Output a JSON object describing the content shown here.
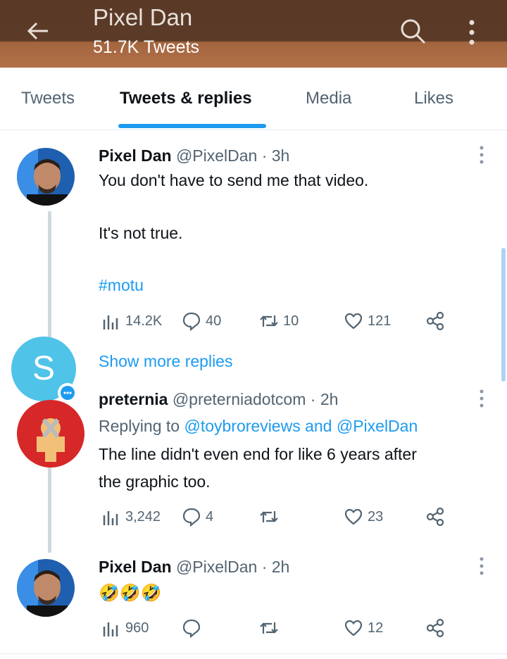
{
  "header": {
    "title": "Pixel Dan",
    "subtitle": "51.7K Tweets"
  },
  "tabs": [
    "Tweets",
    "Tweets & replies",
    "Media",
    "Likes"
  ],
  "tweets": [
    {
      "name": "Pixel Dan",
      "handle": "@PixelDan · 3h",
      "lines": [
        "You don't have to send me that video.",
        "It's not true."
      ],
      "hashtag": "#motu",
      "views": "14.2K",
      "replies": "40",
      "retweets": "10",
      "likes": "121"
    },
    {
      "name": "preternia",
      "handle": "@preterniadotcom · 2h",
      "replying_prefix": "Replying to",
      "replying_to": "@toybroreviews and @PixelDan",
      "lines": [
        "The line didn't even end for like 6 years after",
        "the graphic too."
      ],
      "views": "3,242",
      "replies": "4",
      "retweets": "",
      "likes": "23"
    },
    {
      "name": "Pixel Dan",
      "handle": "@PixelDan · 2h",
      "emoji": "🤣🤣🤣",
      "views": "960",
      "replies": "",
      "retweets": "",
      "likes": "12"
    }
  ],
  "show_more": {
    "avatar_letter": "S",
    "label": "Show more replies"
  }
}
